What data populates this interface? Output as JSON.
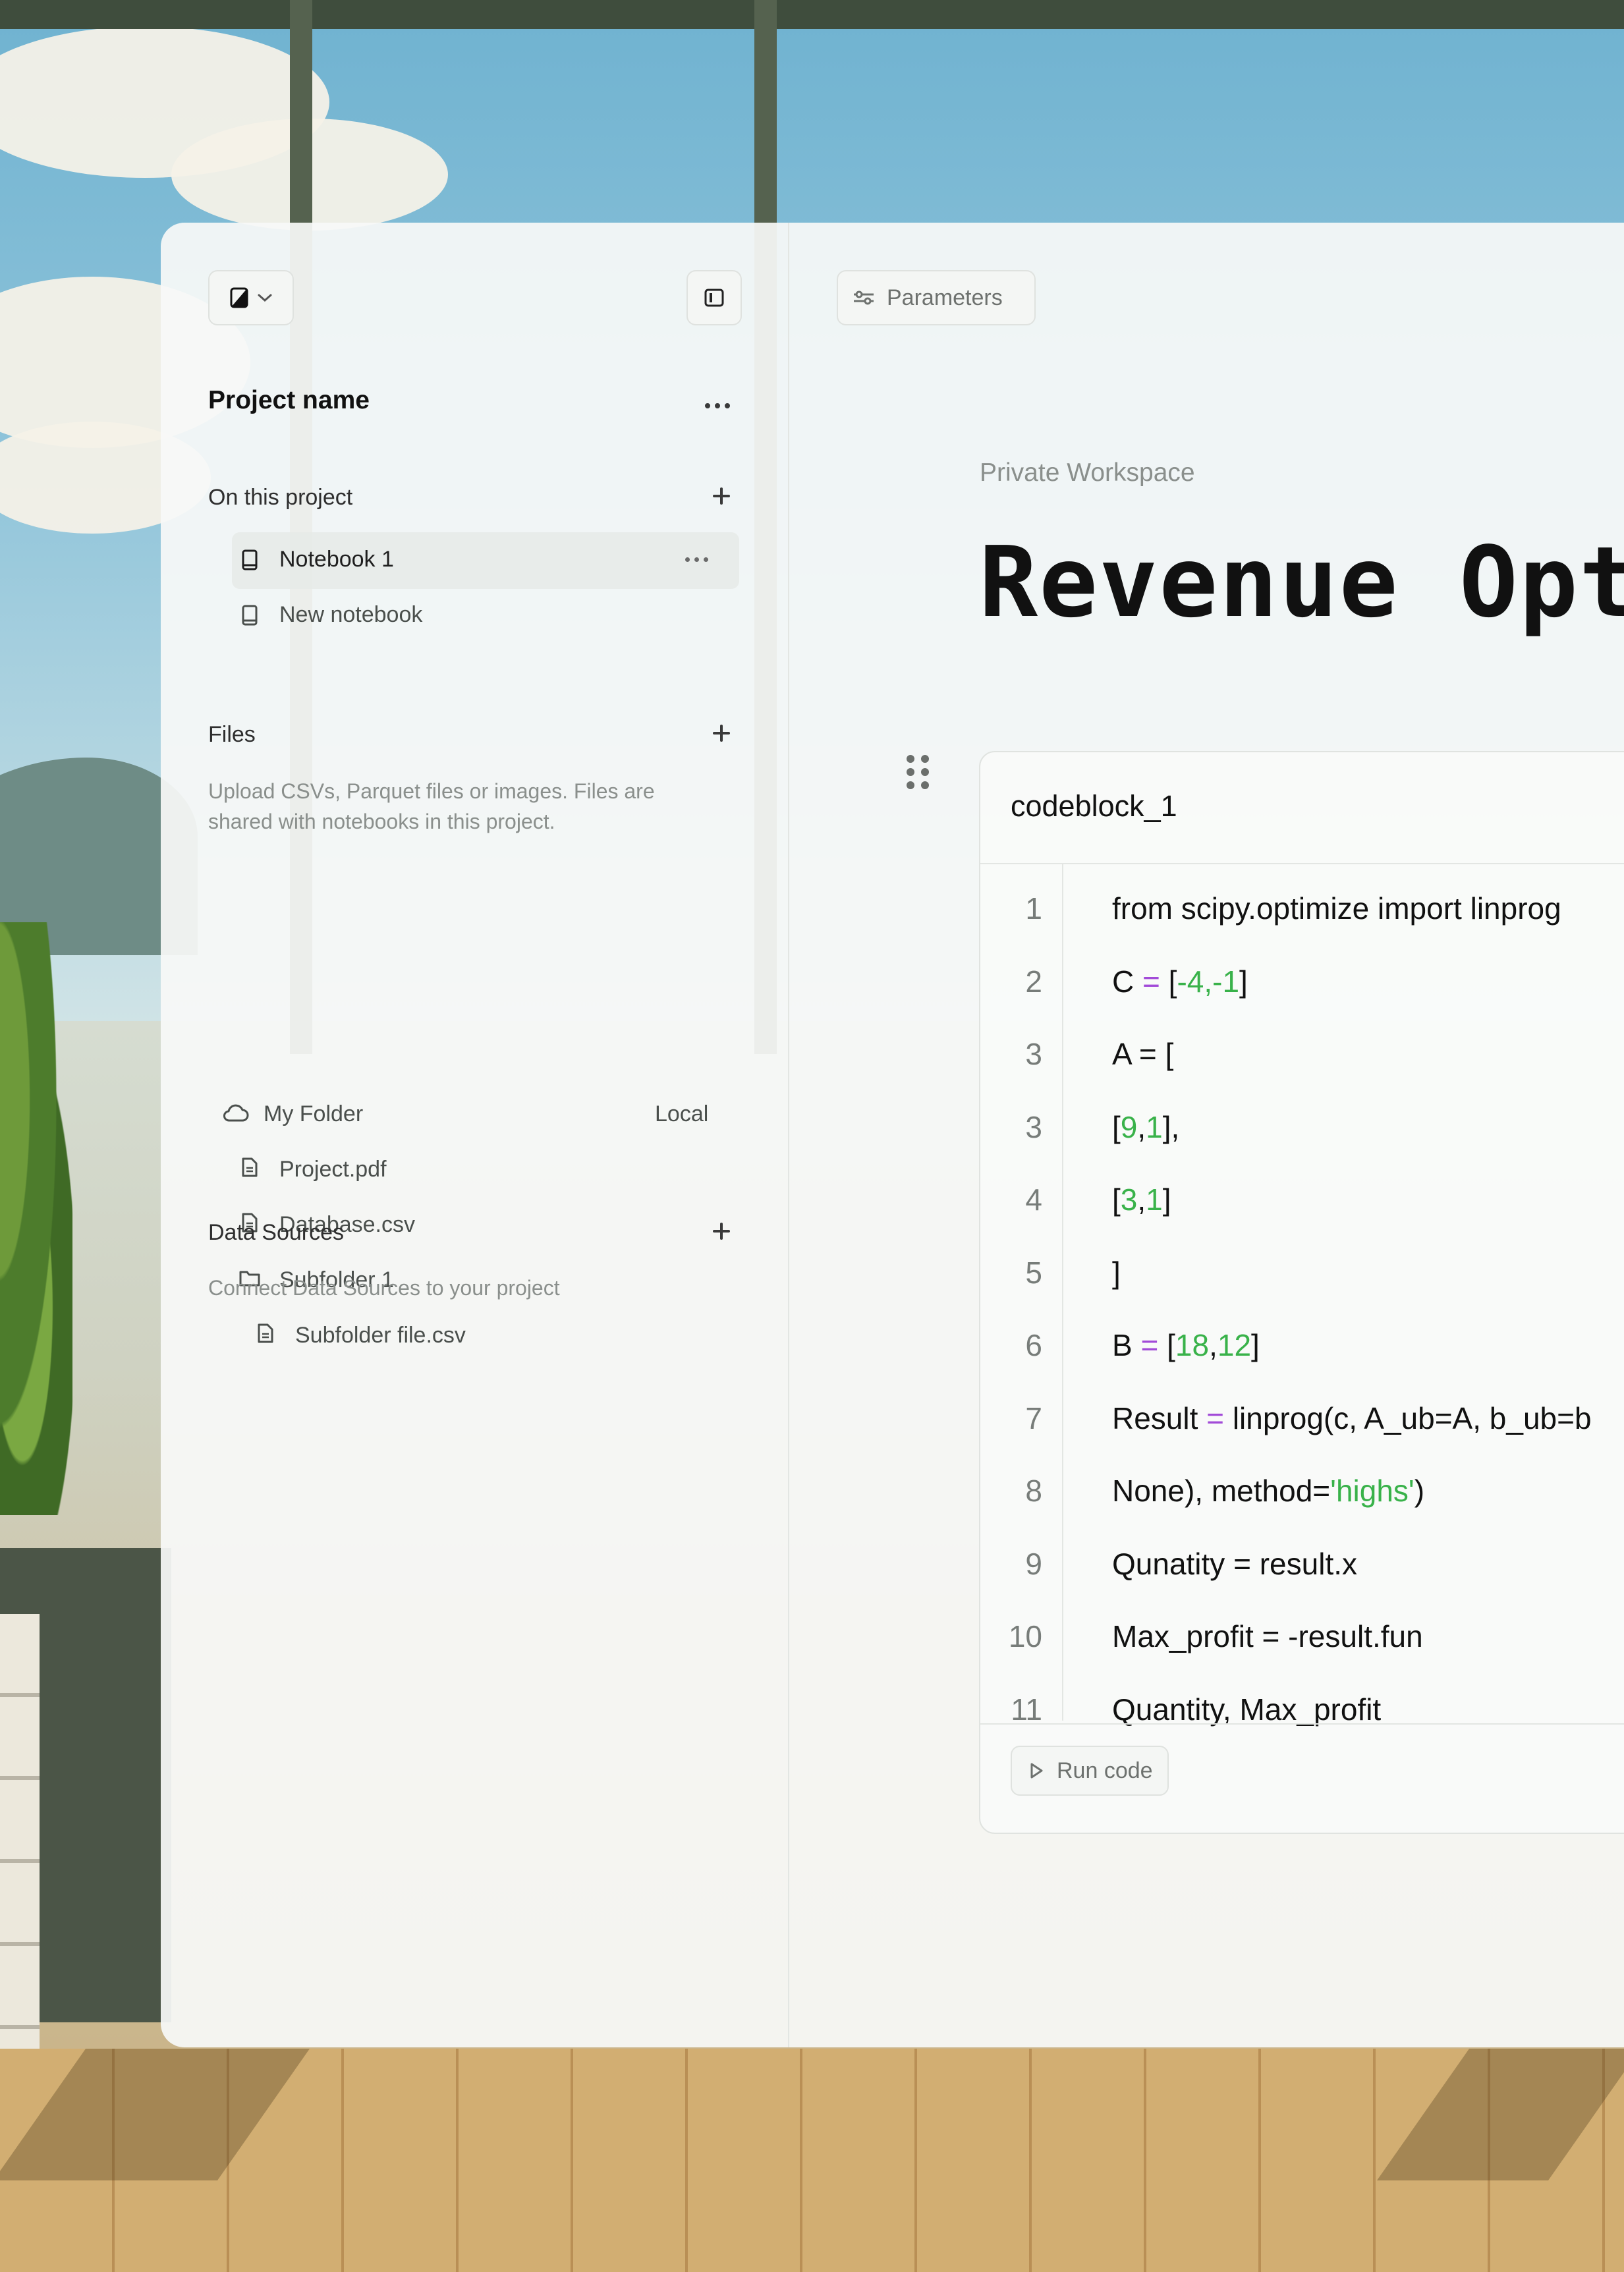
{
  "sidebar": {
    "project_name": "Project name",
    "on_this_project": {
      "label": "On this project",
      "items": [
        {
          "label": "Notebook 1",
          "active": true
        },
        {
          "label": "New notebook",
          "active": false
        }
      ]
    },
    "files": {
      "label": "Files",
      "description": "Upload CSVs, Parquet files or images. Files are shared with notebooks in this project.",
      "folder": {
        "label": "My Folder",
        "badge": "Local"
      },
      "items": [
        {
          "label": "Project.pdf",
          "icon": "file-icon"
        },
        {
          "label": "Database.csv",
          "icon": "file-icon"
        },
        {
          "label": "Subfolder 1",
          "icon": "folder-icon"
        },
        {
          "label": "Subfolder file.csv",
          "icon": "file-icon"
        }
      ]
    },
    "data_sources": {
      "label": "Data Sources",
      "description": "Connect Data Sources to your project"
    }
  },
  "main": {
    "parameters_label": "Parameters",
    "workspace": "Private Workspace",
    "title": "Revenue Opt:",
    "codeblock": {
      "name": "codeblock_1",
      "line_numbers": [
        "1",
        "2",
        "3",
        "3",
        "4",
        "5",
        "6",
        "7",
        "8",
        "9",
        "10",
        "11"
      ],
      "lines": [
        [
          {
            "t": "from scipy.optimize import linprog",
            "k": "plain"
          }
        ],
        [
          {
            "t": "C ",
            "k": "plain"
          },
          {
            "t": "=",
            "k": "op"
          },
          {
            "t": " [",
            "k": "plain"
          },
          {
            "t": "-4,-1",
            "k": "num"
          },
          {
            "t": "]",
            "k": "plain"
          }
        ],
        [
          {
            "t": "A = [",
            "k": "plain"
          }
        ],
        [
          {
            "t": "[",
            "k": "plain"
          },
          {
            "t": "9",
            "k": "num"
          },
          {
            "t": ",",
            "k": "plain"
          },
          {
            "t": "1",
            "k": "num"
          },
          {
            "t": "],",
            "k": "plain"
          }
        ],
        [
          {
            "t": "[",
            "k": "plain"
          },
          {
            "t": "3",
            "k": "num"
          },
          {
            "t": ",",
            "k": "plain"
          },
          {
            "t": "1",
            "k": "num"
          },
          {
            "t": "]",
            "k": "plain"
          }
        ],
        [
          {
            "t": "]",
            "k": "plain"
          }
        ],
        [
          {
            "t": "B ",
            "k": "plain"
          },
          {
            "t": "=",
            "k": "op"
          },
          {
            "t": " [",
            "k": "plain"
          },
          {
            "t": "18",
            "k": "num"
          },
          {
            "t": ",",
            "k": "plain"
          },
          {
            "t": "12",
            "k": "num"
          },
          {
            "t": "]",
            "k": "plain"
          }
        ],
        [
          {
            "t": "Result ",
            "k": "plain"
          },
          {
            "t": "=",
            "k": "op"
          },
          {
            "t": " linprog(c, A_ub=A, b_ub=b",
            "k": "plain"
          }
        ],
        [
          {
            "t": "None), method=",
            "k": "plain"
          },
          {
            "t": "'highs'",
            "k": "str"
          },
          {
            "t": ")",
            "k": "plain"
          }
        ],
        [
          {
            "t": "Qunatity = result.x",
            "k": "plain"
          }
        ],
        [
          {
            "t": "Max_profit = -result.fun",
            "k": "plain"
          }
        ],
        [
          {
            "t": "Quantity, Max_profit",
            "k": "plain"
          }
        ]
      ],
      "run_label": "Run code"
    }
  },
  "colors": {
    "operator": "#a24bd8",
    "number": "#39b24a",
    "muted_text": "#8a8f8c"
  }
}
